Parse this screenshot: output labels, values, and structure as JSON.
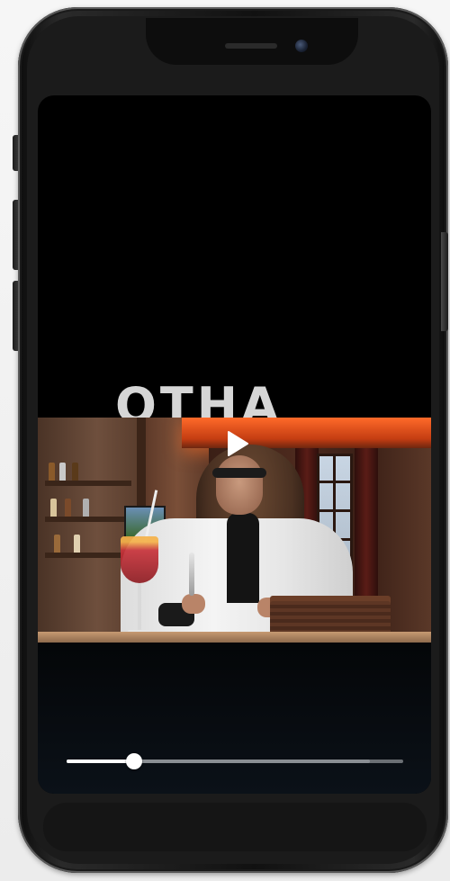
{
  "device": {
    "type": "smartphone-mockup",
    "frame_color": "#1e1e1e"
  },
  "screen": {
    "background": "#000000",
    "overlay_text": "OTHA"
  },
  "video": {
    "state": "paused",
    "play_icon": "play-icon",
    "progress_fraction": 0.2,
    "buffered_fraction": 0.9
  },
  "colors": {
    "progress_fill": "#ffffff",
    "progress_track": "#6b6f74",
    "accent_glow": "#ff6a2a"
  }
}
